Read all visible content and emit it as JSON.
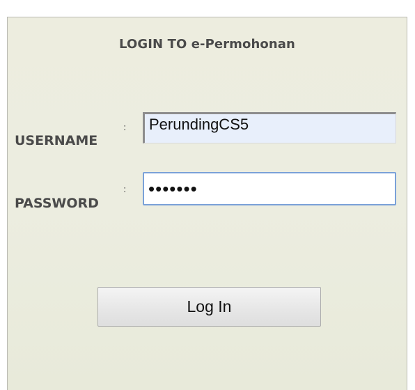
{
  "panel": {
    "title": "LOGIN TO e-Permohonan"
  },
  "form": {
    "username_label": "USERNAME",
    "username_colon": ":",
    "username_value": "PerundingCS5",
    "password_label": "PASSWORD",
    "password_colon": ":",
    "password_value": "•••••••",
    "login_label": "Log In"
  },
  "colors": {
    "panel_background": "#ecede0",
    "username_field_background": "#e8effb",
    "password_focus_border": "#7aa1d8",
    "label_text": "#4a4a4a"
  }
}
